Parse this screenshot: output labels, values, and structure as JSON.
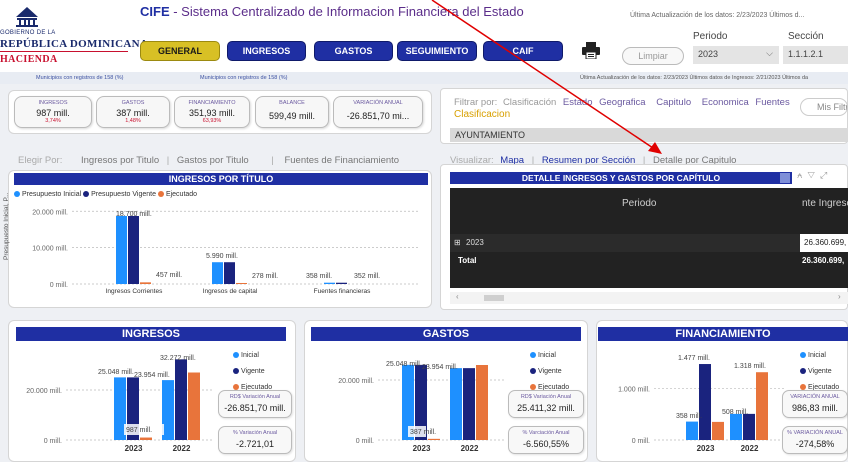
{
  "header": {
    "logo": {
      "line1": "GOBIERNO DE LA",
      "line2": "REPÚBLICA DOMINICANA",
      "line3": "HACIENDA"
    },
    "title_brand": "CIFE",
    "title_rest": " - Sistema Centralizado de Informacion Financiera del Estado",
    "last_update": "Última Actualización de los datos: 2/23/2023 Últimos d...",
    "nav": [
      "GENERAL",
      "INGRESOS",
      "GASTOS",
      "SEGUIMIENTO",
      "CAIF"
    ],
    "limpiar": "Limpiar",
    "periodo_label": "Periodo",
    "seccion_label": "Sección",
    "periodo_value": "2023",
    "seccion_value": "1.1.1.2.1"
  },
  "strip": {
    "left1": "Municipios con registros de 158 (%)",
    "left2": "Municipios con registros de 158 (%)",
    "right": "Última Actualización de los datos: 2/23/2023 Últimos datos de Ingresos: 2/21/2023 Últimos da"
  },
  "kpis": [
    {
      "title": "INGRESOS",
      "value": "987 mill.",
      "pct": "3,74%"
    },
    {
      "title": "GASTOS",
      "value": "387 mill.",
      "pct": "1,48%"
    },
    {
      "title": "FINANCIAMIENTO",
      "value": "351,93 mill.",
      "pct": "63,93%"
    },
    {
      "title": "BALANCE",
      "value": "599,49 mill.",
      "pct": ""
    },
    {
      "title": "VARIACIÓN ANUAL",
      "value": "-26.851,70 mi...",
      "pct": ""
    }
  ],
  "filter": {
    "prefix": "Filtrar por:",
    "options": [
      "Clasificación",
      "Estado",
      "Geografica",
      "Capitulo",
      "Economica",
      "Fuentes"
    ],
    "mis_filtros": "Mis Filtr",
    "active": "Clasificacion",
    "selected_item": "AYUNTAMIENTO"
  },
  "left_tabs": {
    "label": "Elegir Por:",
    "items": [
      "Ingresos por Titulo",
      "Gastos por Titulo",
      "Fuentes de Financiamiento"
    ]
  },
  "right_tabs": {
    "label": "Visualizar:",
    "items": [
      "Mapa",
      "Resumen por Sección",
      "Detalle por Capitulo"
    ]
  },
  "ingresos_titulo": {
    "title": "INGRESOS POR TÍTULO",
    "legend": [
      "Presupuesto Inicial",
      "Presupuesto Vigente",
      "Ejecutado"
    ],
    "ylabel": "Presupuesto Inicial, P...",
    "yticks": [
      "20.000 mill.",
      "10.000 mill.",
      "0 mill."
    ]
  },
  "detalle": {
    "title": "DETALLE INGRESOS Y GASTOS POR CAPÍTULO",
    "col_periodo": "Periodo",
    "col_ingresos": "nte Ingreso",
    "row_year": "2023",
    "row_year_value": "26.360.699,",
    "row_total": "Total",
    "row_total_value": "26.360.699,"
  },
  "cards": {
    "ingresos": {
      "title": "INGRESOS",
      "kpi1_title": "RD$ Variación Anual",
      "kpi1_value": "-26.851,70 mill.",
      "kpi2_title": "% Variación Anual",
      "kpi2_value": "-2.721,01"
    },
    "gastos": {
      "title": "GASTOS",
      "kpi1_title": "RD$ Variación Anual",
      "kpi1_value": "25.411,32 mill.",
      "kpi2_title": "% Varciación Anual",
      "kpi2_value": "-6.560,55%"
    },
    "financiamiento": {
      "title": "FINANCIAMIENTO",
      "kpi1_title": "VARIACIÓN ANUAL",
      "kpi1_value": "986,83 mill.",
      "kpi2_title": "% VARIACIÓN ANUAL",
      "kpi2_value": "-274,58%"
    },
    "legend": [
      "Inicial",
      "Vigente",
      "Ejecutado"
    ]
  },
  "colors": {
    "inicial": "#1e90ff",
    "vigente": "#1a237e",
    "ejecutado": "#e8743b",
    "nav": "#1f2fa3",
    "active": "#d8c025"
  },
  "chart_data": [
    {
      "type": "bar",
      "title": "INGRESOS POR TÍTULO",
      "categories": [
        "Ingresos Corrientes",
        "Ingresos de capital",
        "Fuentes financieras"
      ],
      "series": [
        {
          "name": "Presupuesto Inicial",
          "values": [
            18700,
            5990,
            358
          ]
        },
        {
          "name": "Presupuesto Vigente",
          "values": [
            18700,
            5990,
            352
          ]
        },
        {
          "name": "Ejecutado",
          "values": [
            457,
            278,
            0
          ]
        }
      ],
      "data_labels": [
        "18.700 mill.",
        "457 mill.",
        "5.990 mill.",
        "278 mill.",
        "358 mill.",
        "352 mill."
      ],
      "ylabel": "Presupuesto Inicial, P...",
      "ylim": [
        0,
        22000
      ]
    },
    {
      "type": "bar",
      "title": "INGRESOS",
      "categories": [
        "2023",
        "2022"
      ],
      "series": [
        {
          "name": "Inicial",
          "values": [
            25048,
            23954
          ]
        },
        {
          "name": "Vigente",
          "values": [
            25048,
            32272
          ]
        },
        {
          "name": "Ejecutado",
          "values": [
            987,
            27000
          ]
        }
      ],
      "data_labels": [
        "25.048 mill.",
        "23.954 mill.",
        "32.272 mill.",
        "987 mill."
      ],
      "yticks": [
        "20.000 mill.",
        "0 mill."
      ],
      "ylim": [
        0,
        36000
      ]
    },
    {
      "type": "bar",
      "title": "GASTOS",
      "categories": [
        "2023",
        "2022"
      ],
      "series": [
        {
          "name": "Inicial",
          "values": [
            25048,
            23954
          ]
        },
        {
          "name": "Vigente",
          "values": [
            25048,
            23954
          ]
        },
        {
          "name": "Ejecutado",
          "values": [
            387,
            25000
          ]
        }
      ],
      "data_labels": [
        "25.048 mill.",
        "23.954 mill.",
        "387 mill."
      ],
      "yticks": [
        "20.000 mill.",
        "0 mill."
      ],
      "ylim": [
        0,
        30000
      ]
    },
    {
      "type": "bar",
      "title": "FINANCIAMIENTO",
      "categories": [
        "2023",
        "2022"
      ],
      "series": [
        {
          "name": "Inicial",
          "values": [
            358,
            508
          ]
        },
        {
          "name": "Vigente",
          "values": [
            1477,
            508
          ]
        },
        {
          "name": "Ejecutado",
          "values": [
            352,
            1318
          ]
        }
      ],
      "data_labels": [
        "1.477 mill.",
        "358 mill.",
        "508 mill.",
        "1.318 mill."
      ],
      "yticks": [
        "1.000 mill.",
        "0 mill."
      ],
      "ylim": [
        0,
        1750
      ]
    }
  ]
}
